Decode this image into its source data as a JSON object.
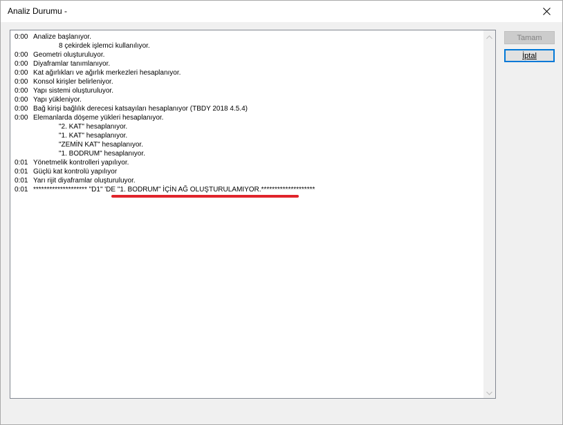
{
  "window": {
    "title": "Analiz Durumu -"
  },
  "buttons": {
    "ok_label": "Tamam",
    "cancel_label": "İptal"
  },
  "log": [
    {
      "time": "0:00",
      "text": "Analize başlanıyor.",
      "indent": false
    },
    {
      "time": "",
      "text": "8 çekirdek işlemci kullanılıyor.",
      "indent": true
    },
    {
      "time": "0:00",
      "text": "Geometri oluşturuluyor.",
      "indent": false
    },
    {
      "time": "0:00",
      "text": "Diyaframlar tanımlanıyor.",
      "indent": false
    },
    {
      "time": "0:00",
      "text": "Kat ağırlıkları ve ağırlık merkezleri hesaplanıyor.",
      "indent": false
    },
    {
      "time": "0:00",
      "text": "Konsol kirişler belirleniyor.",
      "indent": false
    },
    {
      "time": "0:00",
      "text": "Yapı sistemi oluşturuluyor.",
      "indent": false
    },
    {
      "time": "0:00",
      "text": "Yapı yükleniyor.",
      "indent": false
    },
    {
      "time": "0:00",
      "text": "Bağ kirişi bağlılık derecesi katsayıları hesaplanıyor (TBDY 2018 4.5.4)",
      "indent": false
    },
    {
      "time": "0:00",
      "text": "Elemanlarda döşeme yükleri hesaplanıyor.",
      "indent": false
    },
    {
      "time": "",
      "text": "\"2. KAT\" hesaplanıyor.",
      "indent": true
    },
    {
      "time": "",
      "text": "\"1. KAT\" hesaplanıyor.",
      "indent": true
    },
    {
      "time": "",
      "text": "\"ZEMİN KAT\" hesaplanıyor.",
      "indent": true
    },
    {
      "time": "",
      "text": "\"1. BODRUM\" hesaplanıyor.",
      "indent": true
    },
    {
      "time": "0:01",
      "text": "Yönetmelik kontrolleri yapılıyor.",
      "indent": false
    },
    {
      "time": "0:01",
      "text": "Güçlü kat kontrolü yapılıyor",
      "indent": false
    },
    {
      "time": "0:01",
      "text": "Yarı rijit diyaframlar oluşturuluyor.",
      "indent": false
    },
    {
      "time": "0:01",
      "text": "******************** \"D1\" 'DE \"1. BODRUM\" İÇİN AĞ OLUŞTURULAMIYOR.********************",
      "indent": false
    }
  ],
  "icons": {
    "close": "close-icon",
    "scroll_up": "chevron-up-icon",
    "scroll_down": "chevron-down-icon"
  },
  "colors": {
    "highlight_underline": "#e0242b",
    "focus_border": "#0078d7"
  }
}
